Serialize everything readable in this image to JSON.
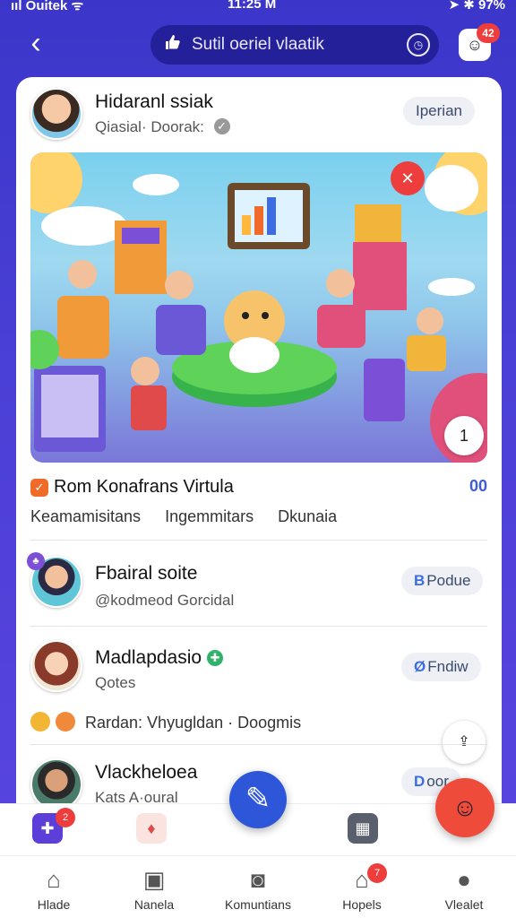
{
  "status_bar": {
    "carrier": "ııl Ouitek ᯤ",
    "time": "11:25 M",
    "battery": "➤ ✱ 97%"
  },
  "header": {
    "back_icon": "chevron-left-icon",
    "search_label": "Sutil oeriel vlaatik",
    "header_badge": "42"
  },
  "profile": {
    "name": "Hidaranl ssiak",
    "subtitle": "Qiasial· Doorak:",
    "action": "Iperian"
  },
  "post": {
    "title": "Rom Konafrans Virtula",
    "count": "00",
    "tags": [
      "Keamamisitans",
      "Ingemmitars",
      "Dkunaia"
    ],
    "fab_label": "1"
  },
  "people": [
    {
      "name": "Fbairal soite",
      "handle": "@kodmeod Gorcidal",
      "action": "Podue",
      "action_mark": "B"
    },
    {
      "name": "Madlapdasio",
      "handle": "Qotes",
      "action": "Fndiw",
      "action_mark": "Ø"
    },
    {
      "name": "Vlackheloea",
      "handle": "Kats A·oural",
      "action": "oor",
      "action_mark": "D"
    }
  ],
  "meta_row": "Rardan: Vhyugldan · Doogmis",
  "tabs": [
    {
      "label": "Hlade",
      "icon": "home-icon"
    },
    {
      "label": "Nanela",
      "icon": "bag-icon"
    },
    {
      "label": "Komuntians",
      "icon": "camera-icon"
    },
    {
      "label": "Hopels",
      "icon": "house-icon"
    },
    {
      "label": "Vlealet",
      "icon": "person-icon"
    }
  ],
  "badges": {
    "action_left": "2",
    "tab_hopels": "7"
  },
  "colors": {
    "primary": "#2d57d8",
    "accent": "#ee3d3d",
    "background": "#3b36c9"
  }
}
